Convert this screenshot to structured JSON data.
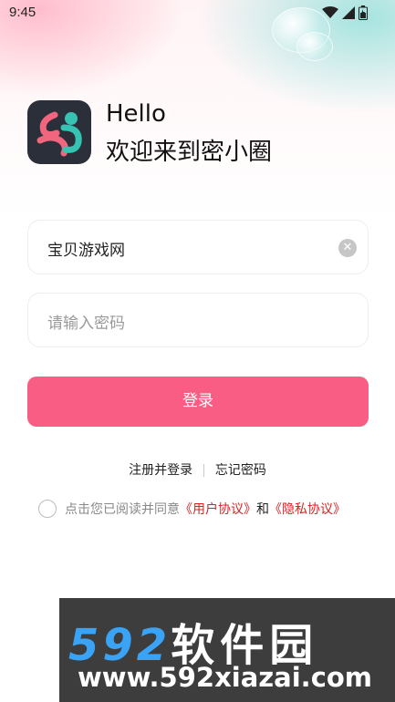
{
  "status_bar": {
    "time": "9:45",
    "icons": [
      "wifi-icon",
      "signal-icon",
      "battery-icon"
    ]
  },
  "header": {
    "greeting": "Hello",
    "welcome": "欢迎来到密小圈"
  },
  "form": {
    "username_value": "宝贝游戏网",
    "password_placeholder": "请输入密码",
    "login_label": "登录"
  },
  "links": {
    "register": "注册并登录",
    "separator": "|",
    "forgot": "忘记密码"
  },
  "agreement": {
    "prefix": "点击您已阅读并同意",
    "user_agreement": "《用户协议》",
    "and": "和",
    "privacy_agreement": "《隐私协议》"
  },
  "watermark": {
    "brand_number": "592",
    "brand_text": "软件园",
    "url": "www.592xiazai.com"
  },
  "colors": {
    "accent": "#fa5d84",
    "link": "#e02020",
    "logo_bg": "#2b2f3a"
  }
}
